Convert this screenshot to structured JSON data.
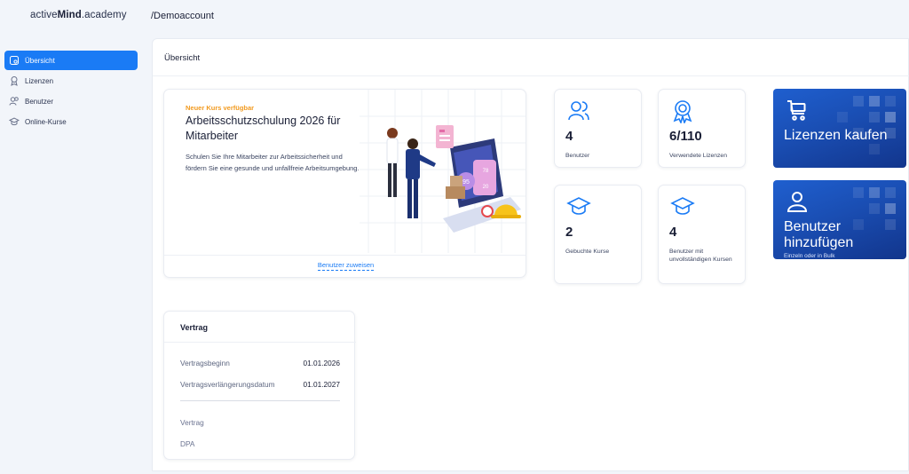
{
  "app": {
    "logo_prefix": "active",
    "logo_bold": "Mind",
    "logo_suffix": ".academy",
    "breadcrumb": "/Demoaccount"
  },
  "sidebar": {
    "items": [
      {
        "label": "Übersicht",
        "icon": "dashboard-icon",
        "active": true
      },
      {
        "label": "Lizenzen",
        "icon": "license-icon",
        "active": false
      },
      {
        "label": "Benutzer",
        "icon": "users-icon",
        "active": false
      },
      {
        "label": "Online-Kurse",
        "icon": "course-icon",
        "active": false
      }
    ]
  },
  "main": {
    "title": "Übersicht",
    "promo": {
      "badge": "Neuer Kurs verfügbar",
      "title": "Arbeitsschutzschulung 2026 für Mitarbeiter",
      "text": "Schulen Sie Ihre Mitarbeiter zur Arbeitssicherheit und fördern Sie eine gesunde und unfallfreie Arbeitsumgebung.",
      "link": "Benutzer zuweisen",
      "illustration_badges": [
        "95",
        "78",
        "20"
      ]
    },
    "stats": [
      {
        "value": "4",
        "label": "Benutzer",
        "icon": "users-icon"
      },
      {
        "value": "6/110",
        "label": "Verwendete Lizenzen",
        "icon": "award-icon"
      },
      {
        "value": "2",
        "label": "Gebuchte Kurse",
        "icon": "graduation-cap-icon"
      },
      {
        "value": "4",
        "label": "Benutzer mit unvollständigen Kursen",
        "icon": "graduation-cap-icon"
      }
    ],
    "tiles": [
      {
        "label": "Lizenzen kaufen",
        "icon": "cart-icon"
      },
      {
        "label": "Benutzer hinzufügen",
        "sub": "Einzeln oder in Bulk",
        "icon": "user-plus-icon"
      }
    ],
    "contract": {
      "title": "Vertrag",
      "rows": [
        {
          "label": "Vertragsbeginn",
          "value": "01.01.2026"
        },
        {
          "label": "Vertragsverlängerungsdatum",
          "value": "01.01.2027"
        }
      ],
      "links": [
        "Vertrag",
        "DPA"
      ]
    }
  },
  "colors": {
    "accent": "#1a7bf5",
    "badge_orange": "#f29a1f",
    "tile_blue": "#1a4eb3",
    "background": "#f2f5fa"
  }
}
